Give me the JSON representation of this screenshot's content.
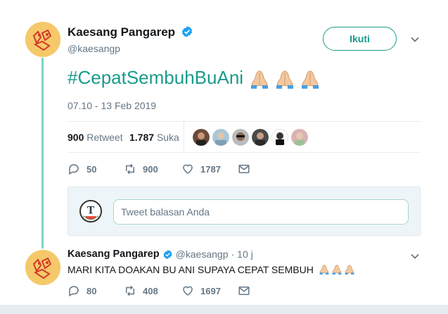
{
  "tweet": {
    "author_name": "Kaesang Pangarep",
    "author_handle": "@kaesangp",
    "follow_label": "Ikuti",
    "text": "#CepatSembuhBuAni",
    "timestamp": "07.10 - 13 Feb 2019",
    "retweets_count": "900",
    "retweets_label": "Retweet",
    "likes_count": "1.787",
    "likes_label": "Suka",
    "actions": {
      "replies": "50",
      "retweets": "900",
      "likes": "1787"
    }
  },
  "reply_box": {
    "placeholder": "Tweet balasan Anda"
  },
  "reply_tweet": {
    "author_name": "Kaesang Pangarep",
    "author_handle": "@kaesangp",
    "separator": "·",
    "time": "10 j",
    "text": "MARI KITA DOAKAN BU ANI SUPAYA CEPAT SEMBUH",
    "actions": {
      "replies": "80",
      "retweets": "408",
      "likes": "1697"
    }
  },
  "colors": {
    "accent": "#1b9a8c",
    "thread_line": "#7dd3c8",
    "muted": "#657786",
    "avatar_bg": "#f5c96a"
  },
  "icons": [
    "verified-icon",
    "chevron-down-icon",
    "folded-hands-emoji",
    "reply-icon",
    "retweet-icon",
    "like-icon",
    "direct-message-icon"
  ]
}
